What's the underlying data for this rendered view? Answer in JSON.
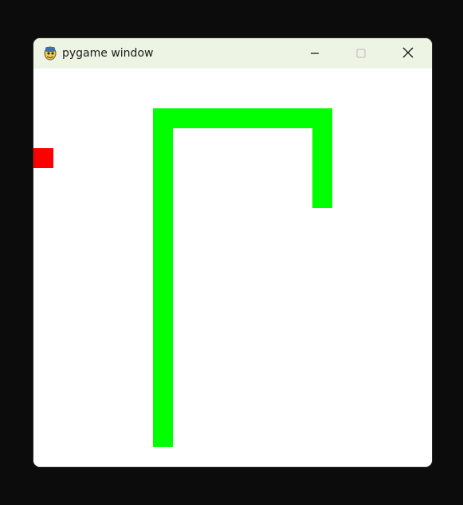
{
  "window": {
    "title": "pygame window",
    "icon": "pygame-snake-icon",
    "controls": [
      "minimize-icon",
      "maximize-icon",
      "close-icon"
    ]
  },
  "game": {
    "colors": {
      "background": "#ffffff",
      "snake": "#00ff00",
      "food": "#ff0000"
    },
    "grid_cell": 25,
    "food": {
      "col": 0,
      "row": 4
    },
    "snake": [
      {
        "col": 14,
        "row": 6
      },
      {
        "col": 14,
        "row": 5
      },
      {
        "col": 14,
        "row": 4
      },
      {
        "col": 14,
        "row": 3
      },
      {
        "col": 14,
        "row": 2
      },
      {
        "col": 13,
        "row": 2
      },
      {
        "col": 12,
        "row": 2
      },
      {
        "col": 11,
        "row": 2
      },
      {
        "col": 10,
        "row": 2
      },
      {
        "col": 9,
        "row": 2
      },
      {
        "col": 8,
        "row": 2
      },
      {
        "col": 7,
        "row": 2
      },
      {
        "col": 6,
        "row": 2
      },
      {
        "col": 6,
        "row": 3
      },
      {
        "col": 6,
        "row": 4
      },
      {
        "col": 6,
        "row": 5
      },
      {
        "col": 6,
        "row": 6
      },
      {
        "col": 6,
        "row": 7
      },
      {
        "col": 6,
        "row": 8
      },
      {
        "col": 6,
        "row": 9
      },
      {
        "col": 6,
        "row": 10
      },
      {
        "col": 6,
        "row": 11
      },
      {
        "col": 6,
        "row": 12
      },
      {
        "col": 6,
        "row": 13
      },
      {
        "col": 6,
        "row": 14
      },
      {
        "col": 6,
        "row": 15
      },
      {
        "col": 6,
        "row": 16
      },
      {
        "col": 6,
        "row": 17
      },
      {
        "col": 6,
        "row": 18
      }
    ]
  }
}
